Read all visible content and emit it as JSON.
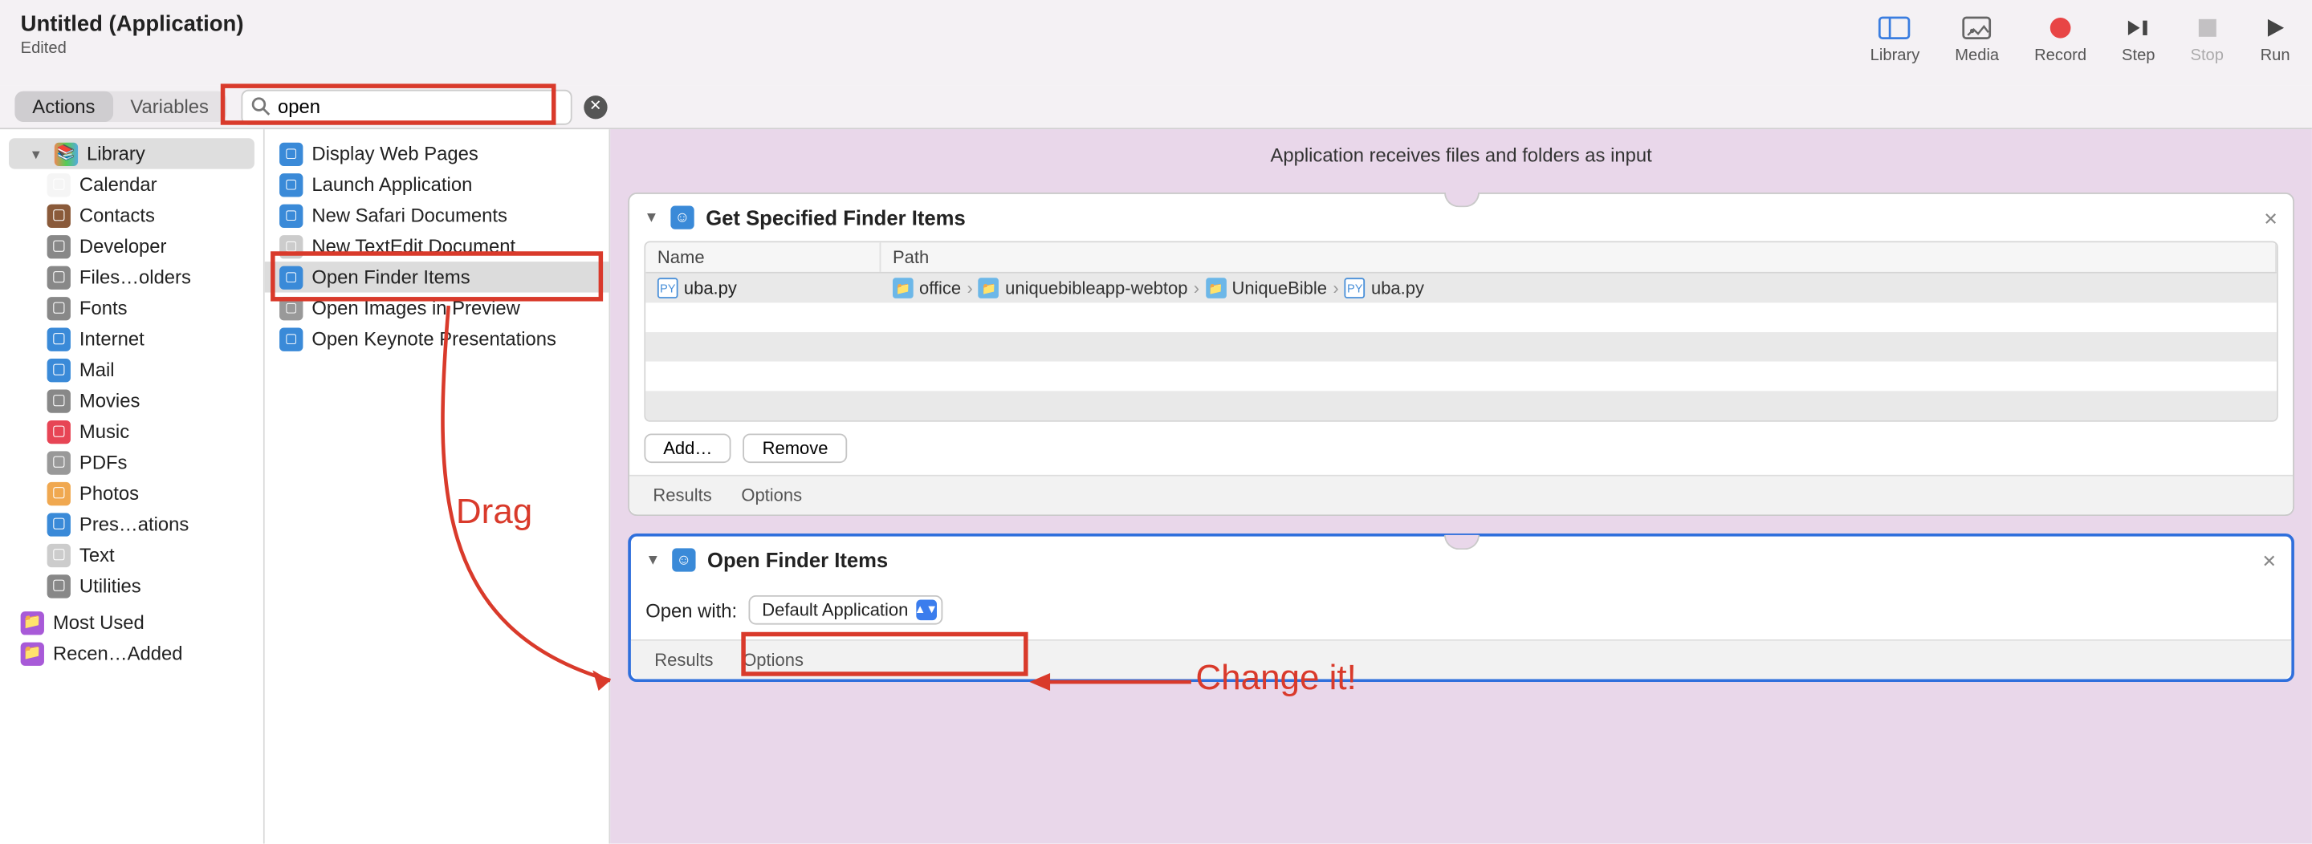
{
  "titlebar": {
    "title": "Untitled (Application)",
    "subtitle": "Edited",
    "buttons": {
      "library": "Library",
      "media": "Media",
      "record": "Record",
      "step": "Step",
      "stop": "Stop",
      "run": "Run"
    }
  },
  "segmented": {
    "actions": "Actions",
    "variables": "Variables"
  },
  "search": {
    "value": "open",
    "placeholder": "Search"
  },
  "library_sidebar": {
    "root": "Library",
    "items": [
      {
        "label": "Calendar",
        "icon": "calendar-icon",
        "color": "#f5f5f5"
      },
      {
        "label": "Contacts",
        "icon": "contacts-icon",
        "color": "#8a5a3a"
      },
      {
        "label": "Developer",
        "icon": "developer-icon",
        "color": "#888"
      },
      {
        "label": "Files…olders",
        "icon": "files-icon",
        "color": "#888"
      },
      {
        "label": "Fonts",
        "icon": "fonts-icon",
        "color": "#888"
      },
      {
        "label": "Internet",
        "icon": "internet-icon",
        "color": "#3a8ad8"
      },
      {
        "label": "Mail",
        "icon": "mail-icon",
        "color": "#3a8ad8"
      },
      {
        "label": "Movies",
        "icon": "movies-icon",
        "color": "#888"
      },
      {
        "label": "Music",
        "icon": "music-icon",
        "color": "#e74555"
      },
      {
        "label": "PDFs",
        "icon": "pdfs-icon",
        "color": "#999"
      },
      {
        "label": "Photos",
        "icon": "photos-icon",
        "color": "#f0a850"
      },
      {
        "label": "Pres…ations",
        "icon": "presentations-icon",
        "color": "#3a8ad8"
      },
      {
        "label": "Text",
        "icon": "text-icon",
        "color": "#ccc"
      },
      {
        "label": "Utilities",
        "icon": "utilities-icon",
        "color": "#888"
      }
    ],
    "most_used": "Most Used",
    "recently_added": "Recen…Added"
  },
  "actions_list": [
    {
      "label": "Display Web Pages",
      "color": "#3a8ad8"
    },
    {
      "label": "Launch Application",
      "color": "#3a8ad8"
    },
    {
      "label": "New Safari Documents",
      "color": "#3a8ad8"
    },
    {
      "label": "New TextEdit Document",
      "color": "#ccc"
    },
    {
      "label": "Open Finder Items",
      "color": "#3a8ad8",
      "selected": true
    },
    {
      "label": "Open Images in Preview",
      "color": "#999"
    },
    {
      "label": "Open Keynote Presentations",
      "color": "#3a8ad8"
    }
  ],
  "canvas": {
    "header": "Application receives files and folders as input",
    "card1": {
      "title": "Get Specified Finder Items",
      "columns": {
        "name": "Name",
        "path": "Path"
      },
      "row": {
        "filename": "uba.py",
        "crumbs": [
          "office",
          "uniquebibleapp-webtop",
          "UniqueBible",
          "uba.py"
        ]
      },
      "add_btn": "Add…",
      "remove_btn": "Remove",
      "results": "Results",
      "options": "Options"
    },
    "card2": {
      "title": "Open Finder Items",
      "open_with_label": "Open with:",
      "open_with_value": "Default Application",
      "results": "Results",
      "options": "Options"
    }
  },
  "annotations": {
    "drag": "Drag",
    "change": "Change it!"
  }
}
